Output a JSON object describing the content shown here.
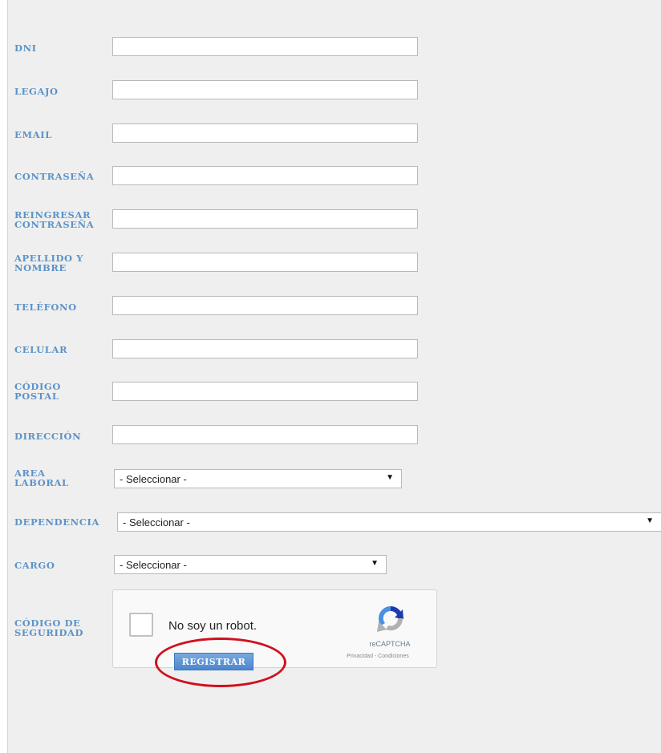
{
  "form": {
    "labels": {
      "dni": "DNI",
      "legajo": "LEGAJO",
      "email": "EMAIL",
      "password": "CONTRASEÑA",
      "password_repeat_1": "REINGRESAR",
      "password_repeat_2": "CONTRASEÑA",
      "name_1": "APELLIDO Y",
      "name_2": "NOMBRE",
      "phone": "TELÉFONO",
      "mobile": "CELULAR",
      "postal_1": "CÓDIGO",
      "postal_2": "POSTAL",
      "address": "DIRECCIÓN",
      "area_1": "AREA",
      "area_2": "LABORAL",
      "dependency": "DEPENDENCIA",
      "position": "CARGO",
      "security_1": "CÓDIGO DE",
      "security_2": "SEGURIDAD"
    },
    "selects": {
      "area": "- Seleccionar -",
      "dependency": "- Seleccionar -",
      "position": "- Seleccionar -"
    },
    "submit_label": "REGISTRAR"
  },
  "captcha": {
    "text": "No soy un robot.",
    "brand": "reCAPTCHA",
    "terms": "Privacidad - Condiciones"
  },
  "colors": {
    "label": "#5c93c8",
    "button": "#4c86cc",
    "highlight": "#d0101e",
    "panel": "#efefef"
  }
}
